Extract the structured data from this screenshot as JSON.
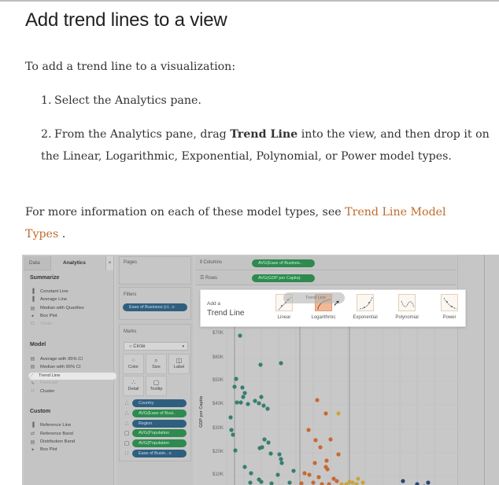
{
  "page": {
    "title": "Add trend lines to a view",
    "intro": "To add a trend line to a visualization:",
    "steps": [
      {
        "num": "1.",
        "text": "Select the Analytics pane."
      },
      {
        "num": "2.",
        "pre": "From the Analytics pane, drag ",
        "bold": "Trend Line",
        "post": " into the view, and then drop it on the Linear, Logarithmic, Exponential, Polynomial, or Power model types."
      }
    ],
    "more_pre": "For more information on each of these model types, see ",
    "more_link": "Trend Line Model Types",
    "more_post": " ."
  },
  "screenshot": {
    "left_pane": {
      "tabs": {
        "data": "Data",
        "analytics": "Analytics",
        "close": "×"
      },
      "summarize": {
        "title": "Summarize",
        "items": [
          {
            "label": "Constant Line",
            "icon": "constant-line-icon",
            "glyph": "▐"
          },
          {
            "label": "Average Line",
            "icon": "average-line-icon",
            "glyph": "▐"
          },
          {
            "label": "Median with Quartiles",
            "icon": "median-quartiles-icon",
            "glyph": "▤"
          },
          {
            "label": "Box Plot",
            "icon": "box-plot-icon",
            "glyph": "✦"
          },
          {
            "label": "Totals",
            "icon": "totals-icon",
            "glyph": "□",
            "disabled": true
          }
        ]
      },
      "model": {
        "title": "Model",
        "items": [
          {
            "label": "Average with 95% CI",
            "icon": "average-ci-icon",
            "glyph": "▤"
          },
          {
            "label": "Median with 95% CI",
            "icon": "median-ci-icon",
            "glyph": "▤"
          },
          {
            "label": "Trend Line",
            "icon": "trend-line-icon",
            "glyph": "⋰",
            "selected": true
          },
          {
            "label": "Forecast",
            "icon": "forecast-icon",
            "glyph": "∿",
            "disabled": true
          },
          {
            "label": "Cluster",
            "icon": "cluster-icon",
            "glyph": "∷"
          }
        ]
      },
      "custom": {
        "title": "Custom",
        "items": [
          {
            "label": "Reference Line",
            "icon": "reference-line-icon",
            "glyph": "▐"
          },
          {
            "label": "Reference Band",
            "icon": "reference-band-icon",
            "glyph": "⇄"
          },
          {
            "label": "Distribution Band",
            "icon": "distribution-band-icon",
            "glyph": "▤"
          },
          {
            "label": "Box Plot",
            "icon": "box-plot-icon",
            "glyph": "✦"
          }
        ]
      }
    },
    "mid_pane": {
      "pages": "Pages",
      "filters": "Filters",
      "filter_pill": "Ease of Business (cl.. ≡",
      "marks": "Marks",
      "mark_type": "Circle",
      "buttons": {
        "color": "Color",
        "size": "Size",
        "label": "Label",
        "detail": "Detail",
        "tooltip": "Tooltip"
      },
      "mark_fields": [
        {
          "label": "Country",
          "type": "blue",
          "icon": "detail-icon",
          "glyph": "∴"
        },
        {
          "label": "AVG(Ease of Busi..",
          "type": "green",
          "icon": "detail-icon",
          "glyph": "∴"
        },
        {
          "label": "Region",
          "type": "blue",
          "icon": "detail-icon",
          "glyph": "∴"
        },
        {
          "label": "AVG(Population",
          "type": "green",
          "icon": "tooltip-icon",
          "glyph": "▢"
        },
        {
          "label": "AVG(Population",
          "type": "green",
          "icon": "tooltip-icon",
          "glyph": "▢"
        },
        {
          "label": "Ease of Busin..  ≡",
          "type": "blue",
          "icon": "color-icon",
          "glyph": "∷"
        }
      ]
    },
    "shelves": {
      "columns_label": "Columns",
      "columns_pill": "AVG(Ease of Busines..",
      "rows_label": "Rows",
      "rows_pill": "AVG(GDP per Capita)"
    },
    "drop_target": {
      "small": "Add a",
      "big": "Trend Line",
      "ghost": "Trend Line",
      "options": [
        "Linear",
        "Logarithmic",
        "Exponential",
        "Polynomial",
        "Power"
      ],
      "hover": "Logarithmic"
    },
    "chart": {
      "y_axis_title": "GDP per Capita",
      "y_ticks": [
        "$70K",
        "$60K",
        "$50K",
        "$40K",
        "$30K",
        "$20K",
        "$10K"
      ],
      "colors": {
        "teal": "#2f7a6c",
        "orange": "#c8642a",
        "gold": "#c7a33a",
        "navy": "#223f73"
      }
    }
  }
}
